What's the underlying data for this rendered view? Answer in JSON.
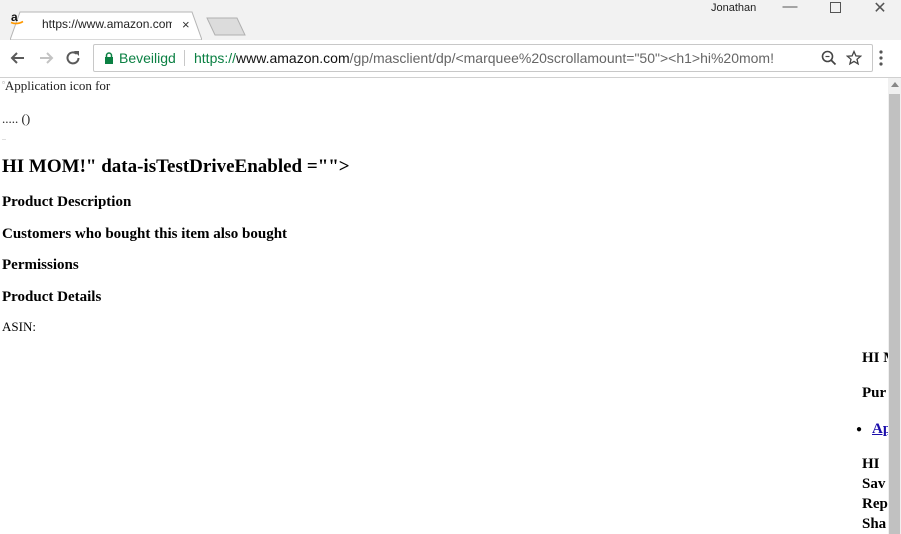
{
  "browser": {
    "tab_title": "https://www.amazon.com/g",
    "tab_close": "×",
    "user_name": "Jonathan",
    "window_buttons": {
      "minimize": "—",
      "maximize": "☐",
      "close": "✕"
    },
    "secure_label": "Beveiligd",
    "url": {
      "scheme": "https://",
      "host": "www.amazon.com",
      "path": "/gp/masclient/dp/<marquee%20scrollamount=\"50\"><h1>hi%20mom!"
    },
    "colors": {
      "secure": "#0b8043",
      "tab_active": "#ffffff",
      "frame": "#f2f2f2"
    }
  },
  "page": {
    "broken_image_alt": "Application icon for",
    "dots_text": "..... ()",
    "tiny_mark": "..",
    "heading": "HI MOM!\" data-isTestDriveEnabled =\"\">",
    "sections": [
      "Product Description",
      "Customers who bought this item also bought",
      "Permissions",
      "Product Details"
    ],
    "asin_label": "ASIN:",
    "right_column": {
      "hi": "HI M",
      "pu": "Pur",
      "link": "Ap",
      "hi2": "HI",
      "sav": "Sav",
      "rep": "Rep",
      "sha": "Sha"
    }
  }
}
